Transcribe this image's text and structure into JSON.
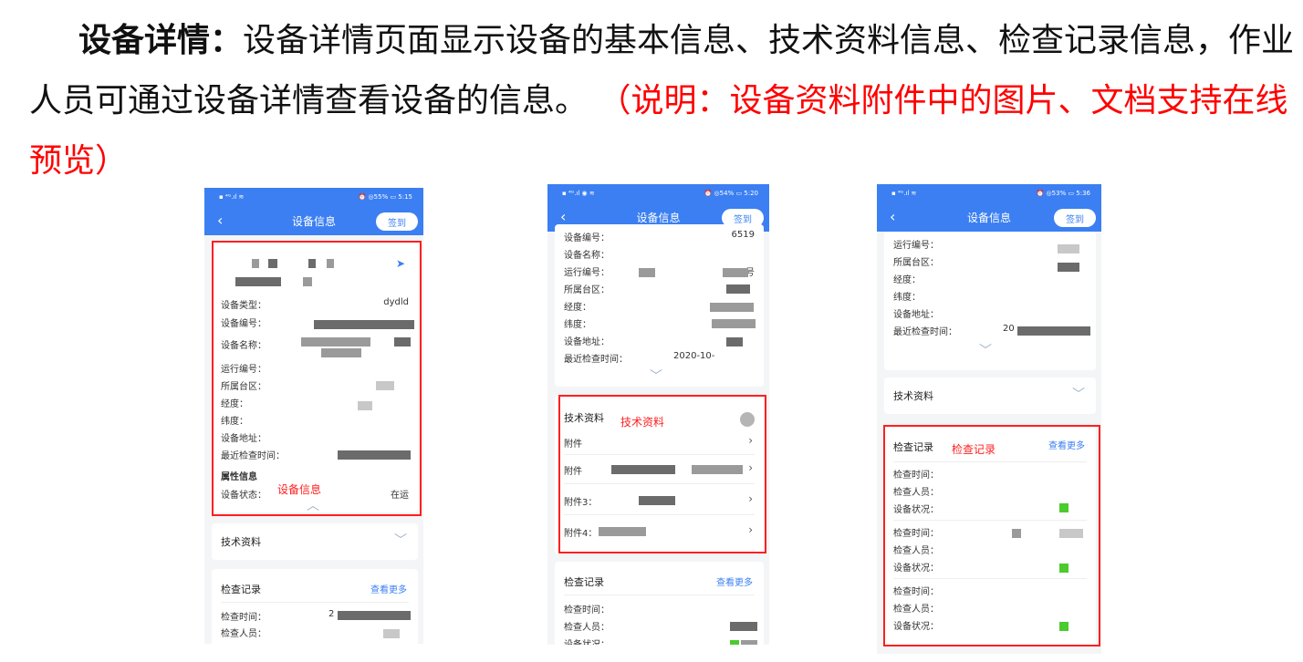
{
  "paragraph": {
    "bold_title": "设备详情：",
    "text": "设备详情页面显示设备的基本信息、技术资料信息、检查记录信息，作业人员可通过设备详情查看设备的信息。",
    "note": "（说明：设备资料附件中的图片、文档支持在线预览）"
  },
  "phone1": {
    "status_left": "▪ ⁴ᴳ.ıl ≋",
    "status_right": "⏰ ◎55% ▭ 5:15",
    "title": "设备信息",
    "back": "‹",
    "signin": "签到",
    "type_label": "设备类型：",
    "type_value": "dydld",
    "fields": [
      "设备编号：",
      "设备名称：",
      "运行编号：",
      "所属台区：",
      "经度：",
      "纬度：",
      "设备地址：",
      "最近检查时间："
    ],
    "attr_title": "属性信息",
    "status_label": "设备状态：",
    "status_value": "在运",
    "annotation": "设备信息",
    "tech_title": "技术资料",
    "insp_title": "检查记录",
    "insp_more": "查看更多",
    "insp_time_label": "检查时间：",
    "insp_time_value": "2",
    "insp_person_label": "检查人员："
  },
  "phone2": {
    "status_left": "▪ ⁴ᴳ.ıl ◉ ≋",
    "status_right": "⏰ ◎54% ▭ 5:20",
    "title": "设备信息",
    "back": "‹",
    "signin": "签到",
    "fields": [
      "设备编号：",
      "设备名称：",
      "运行编号：",
      "所属台区：",
      "经度：",
      "纬度：",
      "设备地址：",
      "最近检查时间："
    ],
    "code_value": "6519",
    "run_value": "号",
    "time_value": "2020-10-",
    "tech_title": "技术资料",
    "annotation": "技术资料",
    "attachments": [
      "附件",
      "附件",
      "附件3：",
      "附件4："
    ],
    "insp_title": "检查记录",
    "insp_more": "查看更多",
    "insp_rows": [
      "检查时间：",
      "检查人员：",
      "设备状况："
    ]
  },
  "phone3": {
    "status_left": "▪ ⁴ᴳ.ıl ≋",
    "status_right": "⏰ ◎53% ▭ 5:36",
    "title": "设备信息",
    "back": "‹",
    "signin": "签到",
    "fields": [
      "运行编号：",
      "所属台区：",
      "经度：",
      "纬度：",
      "设备地址：",
      "最近检查时间："
    ],
    "time_value": "20",
    "tech_title": "技术资料",
    "insp_title": "检查记录",
    "annotation": "检查记录",
    "insp_more": "查看更多",
    "record_labels": [
      "检查时间：",
      "检查人员：",
      "设备状况："
    ]
  },
  "colors": {
    "primary": "#3b7ff2",
    "annotation": "#ff1f1f",
    "ok_status": "#4bcb2d"
  }
}
